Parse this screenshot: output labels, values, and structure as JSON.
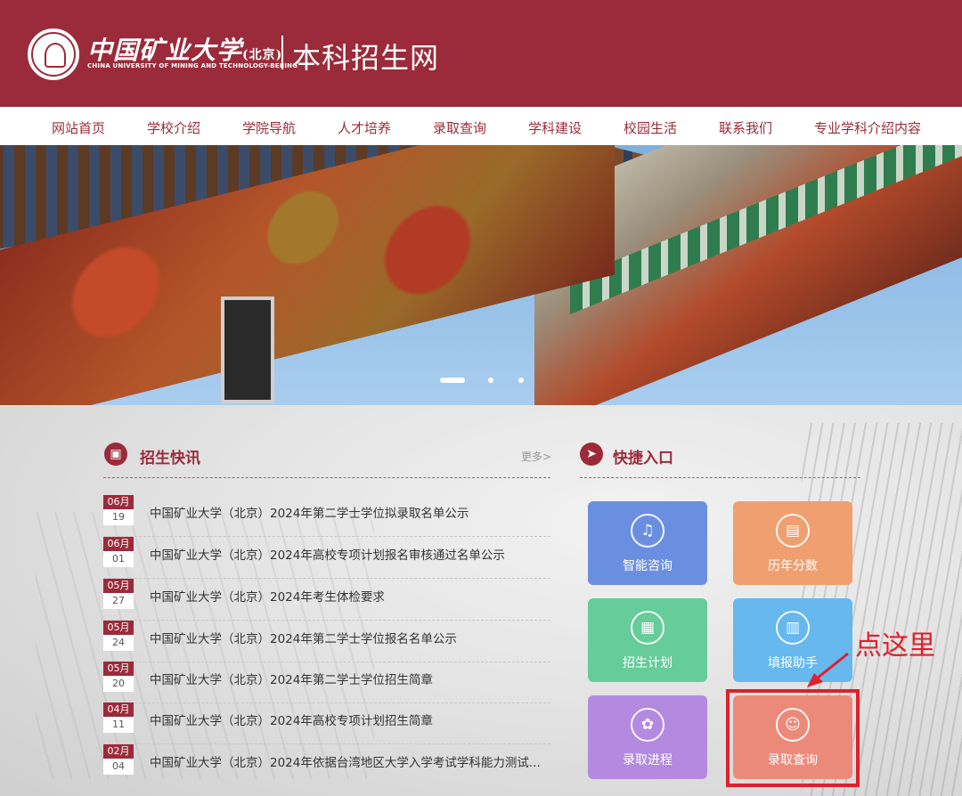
{
  "header": {
    "logo_cn": "中国矿业大学",
    "logo_cn_suffix": "(北京)",
    "logo_en": "CHINA UNIVERSITY OF MINING AND TECHNOLOGY-BEIJING",
    "site_title": "本科招生网"
  },
  "nav": {
    "items": [
      {
        "label": "网站首页"
      },
      {
        "label": "学校介绍"
      },
      {
        "label": "学院导航"
      },
      {
        "label": "人才培养"
      },
      {
        "label": "录取查询"
      },
      {
        "label": "学科建设"
      },
      {
        "label": "校园生活"
      },
      {
        "label": "联系我们"
      },
      {
        "label": "专业学科介绍内容"
      }
    ]
  },
  "news": {
    "title": "招生快讯",
    "more": "更多>",
    "items": [
      {
        "month": "06月",
        "day": "19",
        "title": "中国矿业大学（北京）2024年第二学士学位拟录取名单公示"
      },
      {
        "month": "06月",
        "day": "01",
        "title": "中国矿业大学（北京）2024年高校专项计划报名审核通过名单公示"
      },
      {
        "month": "05月",
        "day": "27",
        "title": "中国矿业大学（北京）2024年考生体检要求"
      },
      {
        "month": "05月",
        "day": "24",
        "title": "中国矿业大学（北京）2024年第二学士学位报名名单公示"
      },
      {
        "month": "05月",
        "day": "20",
        "title": "中国矿业大学（北京）2024年第二学士学位招生简章"
      },
      {
        "month": "04月",
        "day": "11",
        "title": "中国矿业大学（北京）2024年高校专项计划招生简章"
      },
      {
        "month": "02月",
        "day": "04",
        "title": "中国矿业大学（北京）2024年依据台湾地区大学入学考试学科能力测试..."
      }
    ]
  },
  "quick": {
    "title": "快捷入口",
    "tiles": [
      {
        "label": "智能咨询",
        "icon": "bell-icon",
        "color": "#6b8fe0"
      },
      {
        "label": "历年分数",
        "icon": "clipboard-icon",
        "color": "#f0a070"
      },
      {
        "label": "招生计划",
        "icon": "calendar-icon",
        "color": "#66cc99"
      },
      {
        "label": "填报助手",
        "icon": "chart-icon",
        "color": "#66b8ee"
      },
      {
        "label": "录取进程",
        "icon": "flower-icon",
        "color": "#b48ae0"
      },
      {
        "label": "录取查询",
        "icon": "users-icon",
        "color": "#ec8a7a"
      }
    ]
  },
  "annotation": {
    "text": "点这里",
    "color": "#e0202a"
  },
  "colors": {
    "brand": "#9b2b3a"
  }
}
